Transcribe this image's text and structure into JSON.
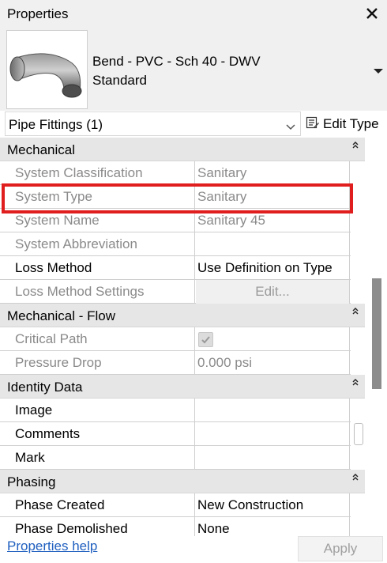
{
  "window": {
    "title": "Properties"
  },
  "type_selector": {
    "line1": "Bend - PVC - Sch 40 - DWV",
    "line2": "Standard"
  },
  "filter": {
    "value": "Pipe Fittings (1)",
    "edit_type_label": "Edit Type"
  },
  "sections": [
    {
      "label": "Mechanical",
      "rows": [
        {
          "name": "System Classification",
          "value": "Sanitary",
          "muted": true
        },
        {
          "name": "System Type",
          "value": "Sanitary",
          "muted": true
        },
        {
          "name": "System Name",
          "value": "Sanitary 45",
          "muted": true
        },
        {
          "name": "System Abbreviation",
          "value": "",
          "muted": true
        },
        {
          "name": "Loss Method",
          "value": "Use Definition on Type",
          "muted": false
        },
        {
          "name": "Loss Method Settings",
          "value": "Edit...",
          "muted": true
        }
      ]
    },
    {
      "label": "Mechanical - Flow",
      "rows": [
        {
          "name": "Critical Path",
          "value": "",
          "muted": true
        },
        {
          "name": "Pressure Drop",
          "value": "0.000 psi",
          "muted": true
        }
      ]
    },
    {
      "label": "Identity Data",
      "rows": [
        {
          "name": "Image",
          "value": "",
          "muted": false
        },
        {
          "name": "Comments",
          "value": "",
          "muted": false
        },
        {
          "name": "Mark",
          "value": "",
          "muted": false
        }
      ]
    },
    {
      "label": "Phasing",
      "rows": [
        {
          "name": "Phase Created",
          "value": "New Construction",
          "muted": false
        },
        {
          "name": "Phase Demolished",
          "value": "None",
          "muted": false
        }
      ]
    }
  ],
  "footer": {
    "help_link": "Properties help",
    "apply_label": "Apply"
  },
  "icons": {
    "close": "close-icon",
    "type_thumbnail": "pipe-bend-thumbnail",
    "dropdown": "chevron-down-icon",
    "edit_type": "edit-type-icon",
    "collapse": "collapse-icon",
    "checkbox": "checkbox-checked-icon"
  },
  "colors": {
    "highlight": "#e01e1e",
    "link": "#1f5fbf",
    "section_bg": "#e6e6e6"
  }
}
